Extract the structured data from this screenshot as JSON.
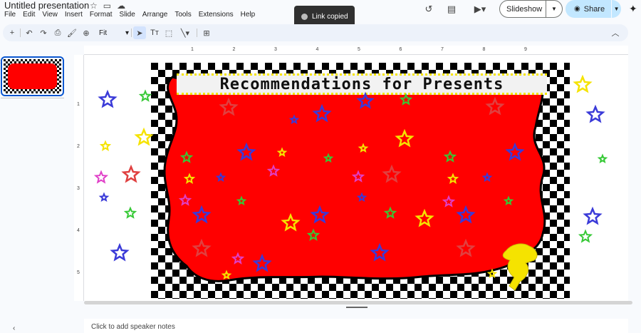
{
  "header": {
    "title": "Untitled presentation",
    "menus": [
      "File",
      "Edit",
      "View",
      "Insert",
      "Format",
      "Slide",
      "Arrange",
      "Tools",
      "Extensions",
      "Help"
    ],
    "slideshow_label": "Slideshow",
    "share_label": "Share"
  },
  "toast": {
    "text": "Link copied"
  },
  "toolbar": {
    "zoom": "Fit"
  },
  "filmstrip": {
    "slide_number": "1"
  },
  "ruler": {
    "horizontal": [
      "1",
      "2",
      "3",
      "4",
      "5",
      "6",
      "7",
      "8",
      "9"
    ],
    "vertical": [
      "1",
      "2",
      "3",
      "4",
      "5"
    ]
  },
  "slide": {
    "banner_text": "Recommendations for Presents",
    "colors": {
      "red": "#ff0000",
      "checker": "#000000"
    }
  },
  "notes": {
    "placeholder": "Click to add speaker notes"
  },
  "colors": {
    "accent": "#0b57d0",
    "share_bg": "#c2e7ff"
  }
}
